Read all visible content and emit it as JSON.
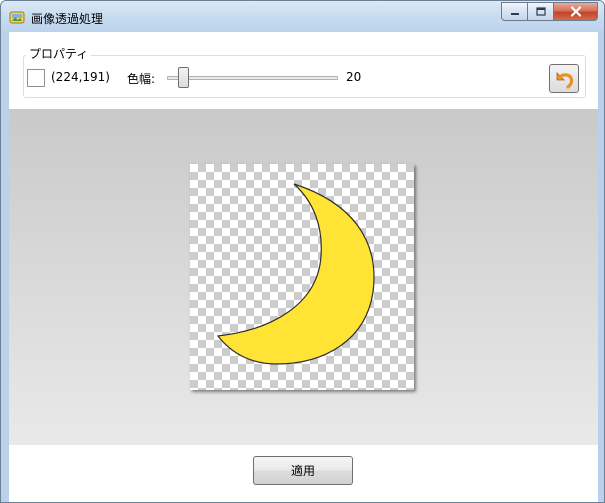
{
  "window": {
    "title": "画像透過処理",
    "icons": {
      "app": "image-app-icon",
      "minimize": "minimize-icon",
      "maximize": "maximize-icon",
      "close": "close-icon"
    }
  },
  "properties": {
    "legend": "プロパティ",
    "picked_color": "#ffffff",
    "coordinates": "(224,191)",
    "width_label": "色幅:",
    "width_value": 20,
    "width_value_text": "20",
    "width_max": 100,
    "undo_icon": "undo-arrow-icon"
  },
  "preview": {
    "image": "crescent-moon",
    "moon_fill": "#ffe335",
    "moon_stroke": "#2e2e2e"
  },
  "actions": {
    "apply_label": "適用"
  },
  "colors": {
    "titlebar": "#c8dcf1",
    "close_button": "#c8492e",
    "undo_arrow": "#e8922a"
  }
}
